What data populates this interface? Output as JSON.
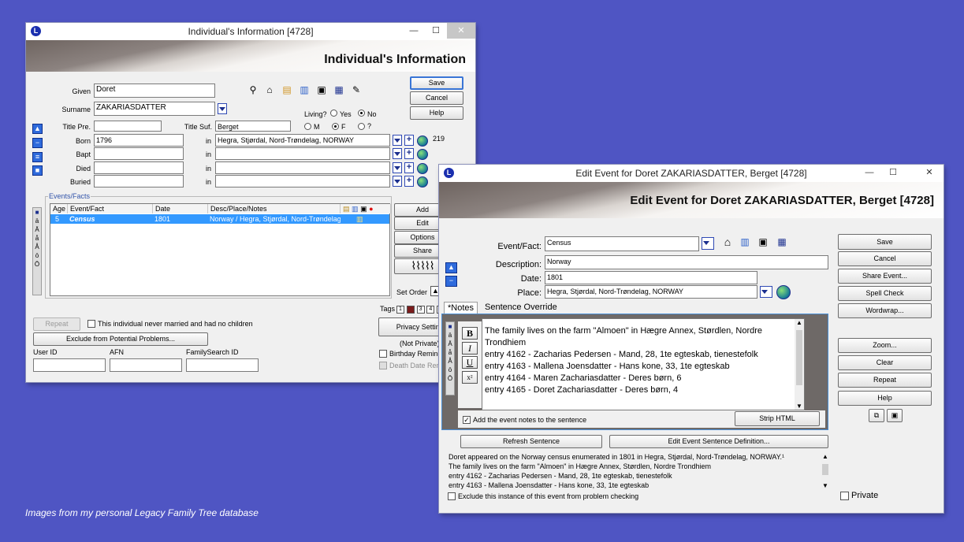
{
  "w1": {
    "title": "Individual's Information  [4728]",
    "banner": "Individual's Information",
    "given_label": "Given",
    "given": "Doret",
    "surname_label": "Surname",
    "surname": "ZAKARIASDATTER",
    "title_pre_label": "Title Pre.",
    "title_pre": "",
    "title_suf_label": "Title Suf.",
    "title_suf": "Berget",
    "living_label": "Living?",
    "living_yes": "Yes",
    "living_no": "No",
    "sex_m": "M",
    "sex_f": "F",
    "sex_q": "?",
    "born_label": "Born",
    "born": "1796",
    "bapt_label": "Bapt",
    "died_label": "Died",
    "buried_label": "Buried",
    "in_label": "in",
    "born_place": "Hegra, Stjørdal, Nord-Trøndelag, NORWAY",
    "count": "219",
    "save": "Save",
    "cancel": "Cancel",
    "help": "Help",
    "events_label": "Events/Facts",
    "columns": [
      "Age",
      "Event/Fact",
      "Date",
      "Desc/Place/Notes"
    ],
    "row": {
      "age": "5",
      "event": "Census",
      "date": "1801",
      "desc": "Norway / Hegra, Stjørdal, Nord-Trøndelag"
    },
    "add": "Add",
    "edit": "Edit",
    "options": "Options",
    "share": "Share",
    "set_order": "Set Order",
    "tags_label": "Tags",
    "tags": [
      "1",
      "2",
      "3",
      "4",
      "5",
      "6"
    ],
    "repeat": "Repeat",
    "never_married": "This individual never married and had no children",
    "exclude": "Exclude from Potential Problems...",
    "privacy": "Privacy Settings",
    "not_private": "(Not Private)",
    "birthday_reminder": "Birthday Reminder",
    "death_date_reminder": "Death Date Reminder",
    "user_id_label": "User ID",
    "afn_label": "AFN",
    "familysearch_label": "FamilySearch ID",
    "alpha": [
      "ä",
      "Ä",
      "å",
      "Å",
      "ö",
      "Ö"
    ]
  },
  "w2": {
    "title": "Edit Event for Doret ZAKARIASDATTER, Berget [4728]",
    "banner": "Edit Event for Doret ZAKARIASDATTER, Berget [4728]",
    "event_label": "Event/Fact:",
    "event": "Census",
    "description_label": "Description:",
    "description": "Norway",
    "date_label": "Date:",
    "date": "1801",
    "place_label": "Place:",
    "place": "Hegra, Stjørdal, Nord-Trøndelag, NORWAY",
    "tab_notes": "*Notes",
    "tab_sentence": "Sentence Override",
    "notes": [
      "The family lives on the farm \"Almoen\" in Hægre Annex, Størdlen, Nordre",
      "Trondhiem",
      "entry 4162 - Zacharias Pedersen - Mand, 28, 1te egteskab, tienestefolk",
      "entry 4163 - Mallena Joensdatter - Hans kone, 33, 1te egteskab",
      "entry 4164 - Maren Zachariasdatter - Deres børn, 6",
      "entry 4165 - Doret Zachariasdatter - Deres børn, 4"
    ],
    "fmt": [
      "B",
      "I",
      "U",
      "x²"
    ],
    "add_notes": "Add the event notes to the sentence",
    "strip_html": "Strip HTML",
    "refresh": "Refresh Sentence",
    "edit_def": "Edit Event Sentence Definition...",
    "sentence": [
      "Doret appeared on the Norway census enumerated in 1801 in Hegra, Stjørdal, Nord-Trøndelag, NORWAY.¹",
      "The family lives on the farm \"Almoen\" in Hægre Annex, Størdlen, Nordre Trondhiem",
      "entry 4162 - Zacharias Pedersen - Mand, 28, 1te egteskab, tienestefolk",
      "entry 4163 - Mallena Joensdatter - Hans kone, 33, 1te egteskab"
    ],
    "exclude": "Exclude this instance of this event from problem checking",
    "private": "Private",
    "buttons": [
      "Save",
      "Cancel",
      "Share Event...",
      "Spell Check",
      "Wordwrap...",
      "Zoom...",
      "Clear",
      "Repeat",
      "Help"
    ],
    "alpha": [
      "ä",
      "Ä",
      "å",
      "Å",
      "ö",
      "Ö"
    ]
  },
  "caption": "Images from my personal Legacy Family Tree database"
}
